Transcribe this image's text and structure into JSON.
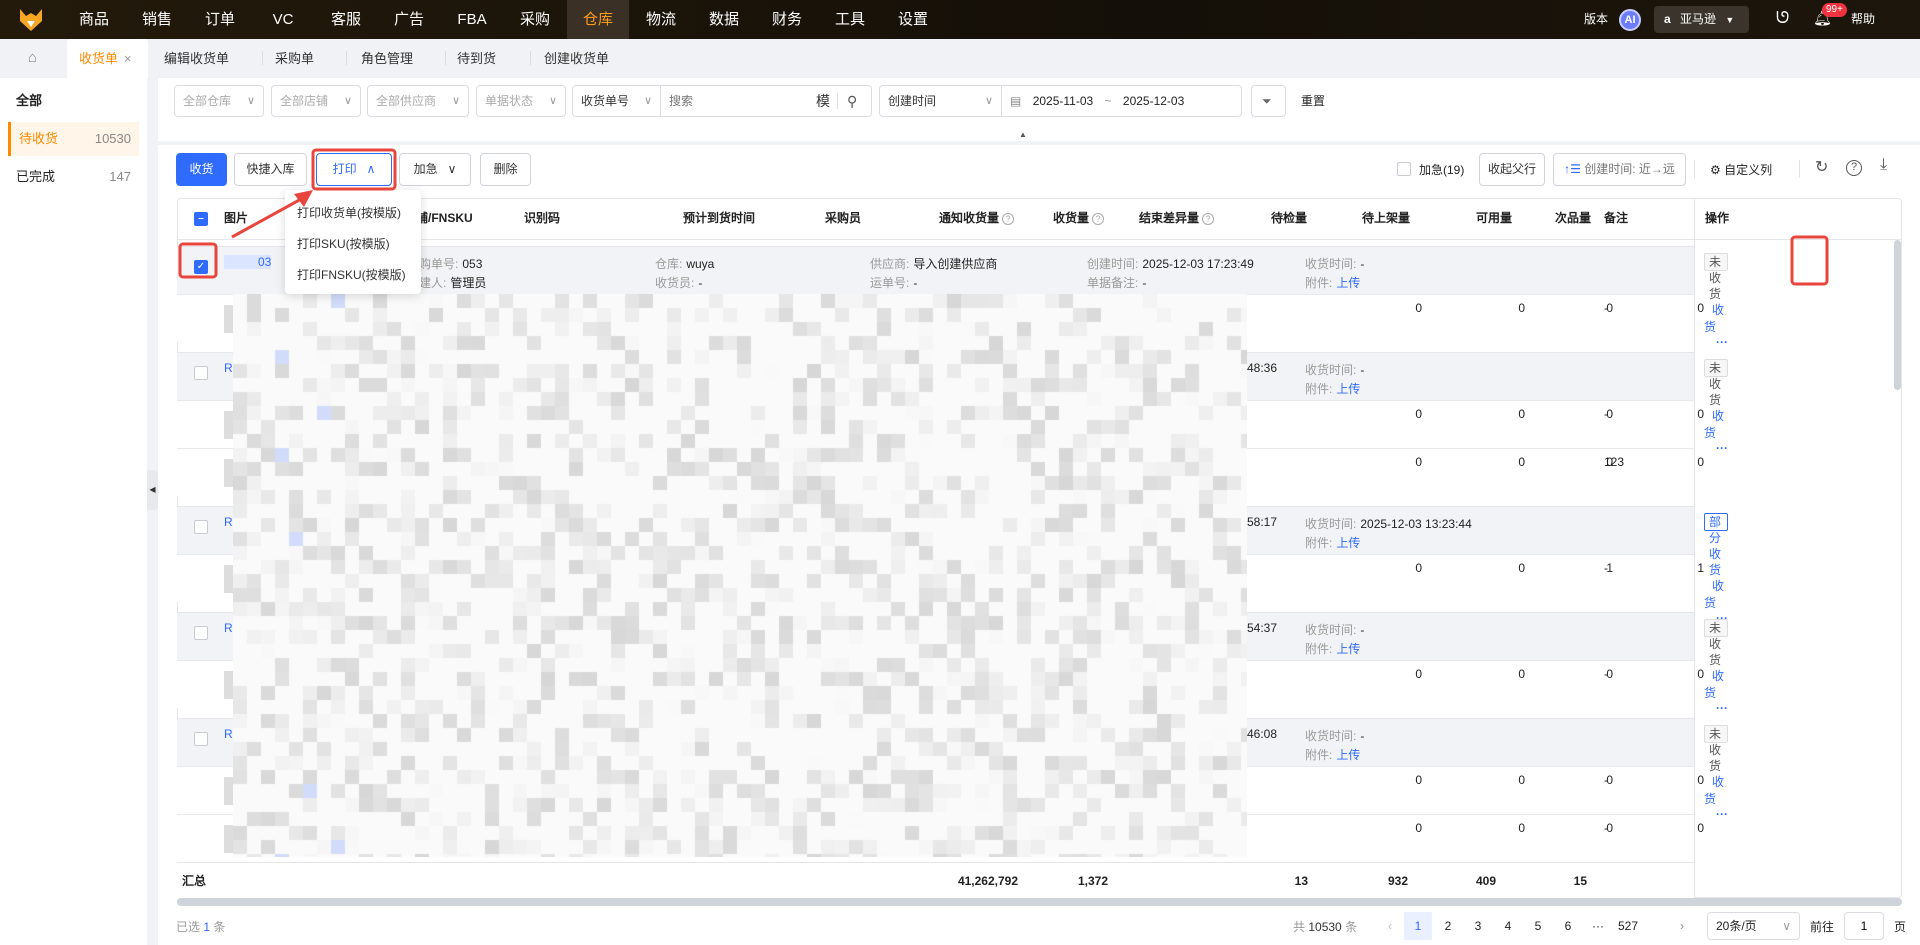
{
  "topnav": {
    "items": [
      "商品",
      "销售",
      "订单",
      "VC",
      "客服",
      "广告",
      "FBA",
      "采购",
      "仓库",
      "物流",
      "数据",
      "财务",
      "工具",
      "设置"
    ],
    "active": "仓库",
    "version": "版本",
    "ai": "AI",
    "store": "亚马逊",
    "notif_badge": "99+",
    "help": "帮助"
  },
  "tabs": {
    "items": [
      {
        "label": "收货单",
        "active": true
      },
      {
        "label": "编辑收货单"
      },
      {
        "label": "采购单"
      },
      {
        "label": "角色管理"
      },
      {
        "label": "待到货"
      },
      {
        "label": "创建收货单"
      }
    ],
    "close": "×"
  },
  "sidebar": {
    "items": [
      {
        "label": "全部",
        "count": ""
      },
      {
        "label": "待收货",
        "count": "10530"
      },
      {
        "label": "已完成",
        "count": "147"
      }
    ]
  },
  "filters": {
    "warehouse": "全部仓库",
    "store": "全部店铺",
    "supplier": "全部供应商",
    "status": "单据状态",
    "search_field": "收货单号",
    "search_placeholder": "搜索",
    "fuzzy": "模",
    "date_field": "创建时间",
    "date_start": "2025-11-03",
    "date_sep": "~",
    "date_end": "2025-12-03",
    "reset": "重置"
  },
  "toolbar": {
    "receive": "收货",
    "quick_stock": "快捷入库",
    "print": "打印",
    "urgent": "加急",
    "delete": "删除",
    "urgent_filter": "加急(19)",
    "collapse_parent": "收起父行",
    "sort": "创建时间: 近→远",
    "custom_cols": "自定义列"
  },
  "print_menu": [
    "打印收货单(按模版)",
    "打印SKU(按模版)",
    "打印FNSKU(按模版)"
  ],
  "table": {
    "headers": {
      "image": "图片",
      "sku": "铺/FNSKU",
      "code": "识别码",
      "eta": "预计到货时间",
      "buyer": "采购员",
      "notified": "通知收货量",
      "received": "收货量",
      "diff": "结束差异量",
      "inspect": "待检量",
      "shelve": "待上架量",
      "available": "可用量",
      "defective": "次品量",
      "remark": "备注",
      "ops": "操作"
    },
    "labels": {
      "po": "采购单号:",
      "creator": "创建人:",
      "warehouse": "仓库:",
      "receiver": "收货员:",
      "supplier": "供应商:",
      "waybill": "运单号:",
      "created": "创建时间:",
      "note": "单据备注:",
      "recv_time": "收货时间:",
      "attach": "附件:",
      "upload": "上传",
      "receive": "收货",
      "more": "···"
    },
    "groups": [
      {
        "id_tail": "03",
        "po_tail": "053",
        "creator": "管理员",
        "warehouse": "wuya",
        "receiver": "-",
        "supplier": "导入创建供应商",
        "waybill": "-",
        "created": "2025-12-03 17:23:49",
        "note": "-",
        "recv_time": "-",
        "status": "未收货",
        "checked": true,
        "children": [
          [
            "0",
            "0",
            "0",
            "0",
            "-"
          ]
        ]
      },
      {
        "id_tail": "R",
        "created_tail": "48:36",
        "recv_time": "-",
        "status": "未收货",
        "children": [
          [
            "0",
            "0",
            "0",
            "0",
            "-"
          ],
          [
            "0",
            "0",
            "0",
            "0",
            "123"
          ]
        ]
      },
      {
        "id_tail": "R",
        "created_tail": "58:17",
        "recv_time": "2025-12-03 13:23:44",
        "status": "部分收货",
        "children": [
          [
            "0",
            "0",
            "1",
            "1",
            "-"
          ]
        ]
      },
      {
        "id_tail": "R",
        "created_tail": "54:37",
        "recv_time": "-",
        "status": "未收货",
        "children": [
          [
            "0",
            "0",
            "0",
            "0",
            "-"
          ]
        ]
      },
      {
        "id_tail": "R",
        "created_tail": "46:08",
        "recv_time": "-",
        "status": "未收货",
        "children": [
          [
            "0",
            "0",
            "0",
            "0",
            "-"
          ],
          [
            "0",
            "0",
            "0",
            "0",
            "-"
          ]
        ]
      }
    ],
    "summary": {
      "label": "汇总",
      "notified": "41,262,792",
      "received": "1,372",
      "inspect": "13",
      "shelve": "932",
      "available": "409",
      "defective": "15"
    }
  },
  "footer": {
    "selected_prefix": "已选",
    "selected": "1",
    "selected_suffix": "条",
    "total_prefix": "共",
    "total": "10530",
    "total_suffix": "条",
    "pages": [
      "1",
      "2",
      "3",
      "4",
      "5",
      "6",
      "···",
      "527"
    ],
    "current_page": "1",
    "page_size": "20条/页",
    "goto": "前往",
    "goto_value": "1",
    "page_suffix": "页"
  },
  "colors": {
    "accent": "#ff8a00",
    "primary": "#2f6bff",
    "annotation": "#e8453c"
  }
}
